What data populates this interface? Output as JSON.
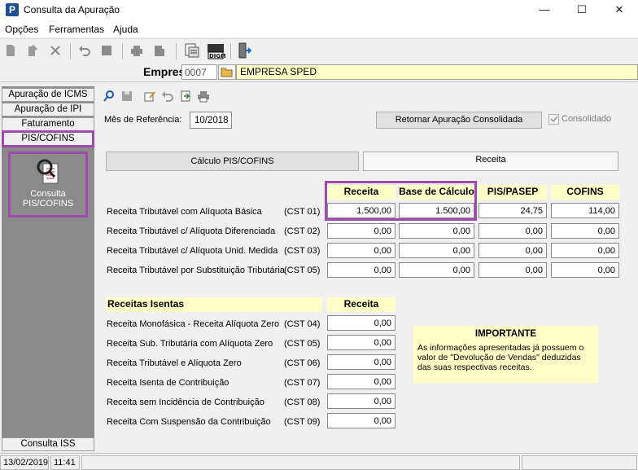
{
  "window": {
    "title": "Consulta da Apuração",
    "minimize": "—",
    "maximize": "☐",
    "close": "✕"
  },
  "menu": {
    "options": "Opções",
    "tools": "Ferramentas",
    "help": "Ajuda"
  },
  "company": {
    "label": "Empresa",
    "code": "0007",
    "name": "EMPRESA SPED"
  },
  "sidebar": {
    "tabs": [
      "Apuração de ICMS",
      "Apuração de IPI",
      "Faturamento",
      "PIS/COFINS"
    ],
    "item_label_line1": "Consulta",
    "item_label_line2": "PIS/COFINS",
    "bottom_tab": "Consulta ISS"
  },
  "header": {
    "mes_ref_label": "Mês de Referência:",
    "mes_ref_value": "10/2018",
    "retornar_button": "Retornar Apuração Consolidada",
    "consolidado_label": "Consolidado",
    "consolidado_checked": true
  },
  "tabs": {
    "calculo": "Cálculo PIS/COFINS",
    "receita": "Receita"
  },
  "table": {
    "columns": [
      "Receita",
      "Base de Cálculo",
      "PIS/PASEP",
      "COFINS"
    ],
    "rows": [
      {
        "label": "Receita Tributável com Alíquota Básica",
        "cst": "(CST 01)",
        "receita": "1.500,00",
        "base": "1.500,00",
        "pis": "24,75",
        "cofins": "114,00"
      },
      {
        "label": "Receita Tributável c/ Alíquota Diferenciada",
        "cst": "(CST 02)",
        "receita": "0,00",
        "base": "0,00",
        "pis": "0,00",
        "cofins": "0,00"
      },
      {
        "label": "Receita Tributável c/ Alíquota Unid. Medida",
        "cst": "(CST 03)",
        "receita": "0,00",
        "base": "0,00",
        "pis": "0,00",
        "cofins": "0,00"
      },
      {
        "label": "Receita Tributável por Substituição Tributária",
        "cst": "(CST 05)",
        "receita": "0,00",
        "base": "0,00",
        "pis": "0,00",
        "cofins": "0,00"
      }
    ]
  },
  "isentas": {
    "title": "Receitas Isentas",
    "column": "Receita",
    "rows": [
      {
        "label": "Receita Monofásica - Receita Alíquota Zero",
        "cst": "(CST 04)",
        "value": "0,00"
      },
      {
        "label": "Receita Sub. Tributária com Alíquota Zero",
        "cst": "(CST 05)",
        "value": "0,00"
      },
      {
        "label": "Receita Tributável e Alíquota Zero",
        "cst": "(CST 06)",
        "value": "0,00"
      },
      {
        "label": "Receita Isenta de Contribuição",
        "cst": "(CST 07)",
        "value": "0,00"
      },
      {
        "label": "Receita sem Incidência de Contribuição",
        "cst": "(CST 08)",
        "value": "0,00"
      },
      {
        "label": "Receita Com Suspensão da Contribuição",
        "cst": "(CST 09)",
        "value": "0,00"
      }
    ]
  },
  "note": {
    "title": "IMPORTANTE",
    "text": "As informações apresentadas já possuem o valor de \"Devolução de Vendas\" deduzidas das suas respectivas receitas."
  },
  "status": {
    "date": "13/02/2019",
    "time": "11:41"
  },
  "colors": {
    "highlight": "#a149b0",
    "yellow": "#ffffc8",
    "sidebar": "#8a8a8a"
  }
}
